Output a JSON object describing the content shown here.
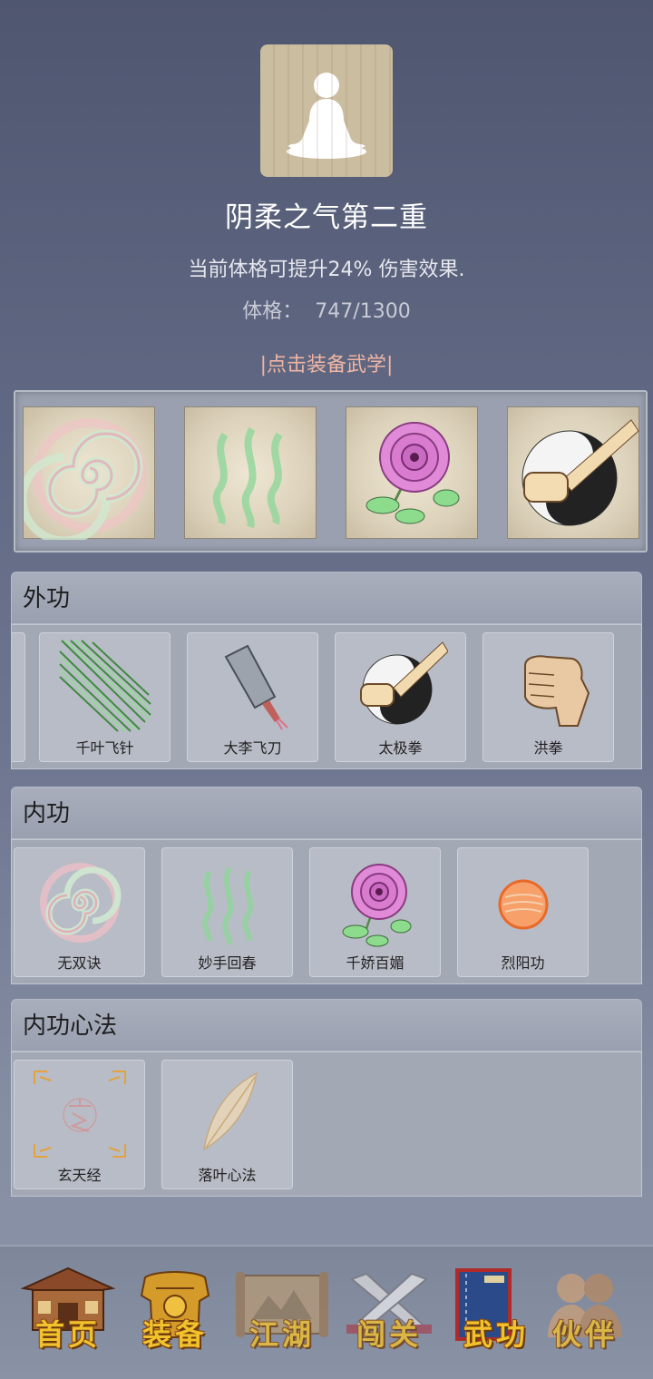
{
  "header": {
    "avatar_icon": "meditation-figure-icon",
    "title": "阴柔之气第二重",
    "description": "当前体格可提升24% 伤害效果.",
    "stat_label": "体格：",
    "stat_value": "747/1300",
    "equip_link": "|点击装备武学|"
  },
  "equipped": [
    {
      "icon": "spiral-qi-icon"
    },
    {
      "icon": "green-wisps-icon"
    },
    {
      "icon": "pink-rose-icon"
    },
    {
      "icon": "taiji-fist-icon"
    }
  ],
  "sections": [
    {
      "title": "外功",
      "cards": [
        {
          "label": "千叶飞针",
          "icon": "green-needles-icon"
        },
        {
          "label": "大李飞刀",
          "icon": "cleaver-icon"
        },
        {
          "label": "太极拳",
          "icon": "taiji-fist-icon"
        },
        {
          "label": "洪拳",
          "icon": "fist-icon"
        }
      ]
    },
    {
      "title": "内功",
      "cards": [
        {
          "label": "无双诀",
          "icon": "spiral-qi-icon"
        },
        {
          "label": "妙手回春",
          "icon": "green-wisps-icon"
        },
        {
          "label": "千娇百媚",
          "icon": "pink-rose-icon"
        },
        {
          "label": "烈阳功",
          "icon": "orange-sun-icon"
        }
      ]
    },
    {
      "title": "内功心法",
      "cards": [
        {
          "label": "玄天经",
          "icon": "xuan-seal-icon"
        },
        {
          "label": "落叶心法",
          "icon": "falling-leaf-icon"
        }
      ]
    }
  ],
  "nav": [
    {
      "label": "首页",
      "icon": "temple-icon"
    },
    {
      "label": "装备",
      "icon": "armor-icon"
    },
    {
      "label": "江湖",
      "icon": "scroll-map-icon"
    },
    {
      "label": "闯关",
      "icon": "crossed-swords-icon"
    },
    {
      "label": "武功",
      "icon": "martial-book-icon"
    },
    {
      "label": "伙伴",
      "icon": "partners-icon"
    }
  ],
  "colors": {
    "accent_link": "#f0b5a3",
    "nav_label": "#f2c22c"
  }
}
